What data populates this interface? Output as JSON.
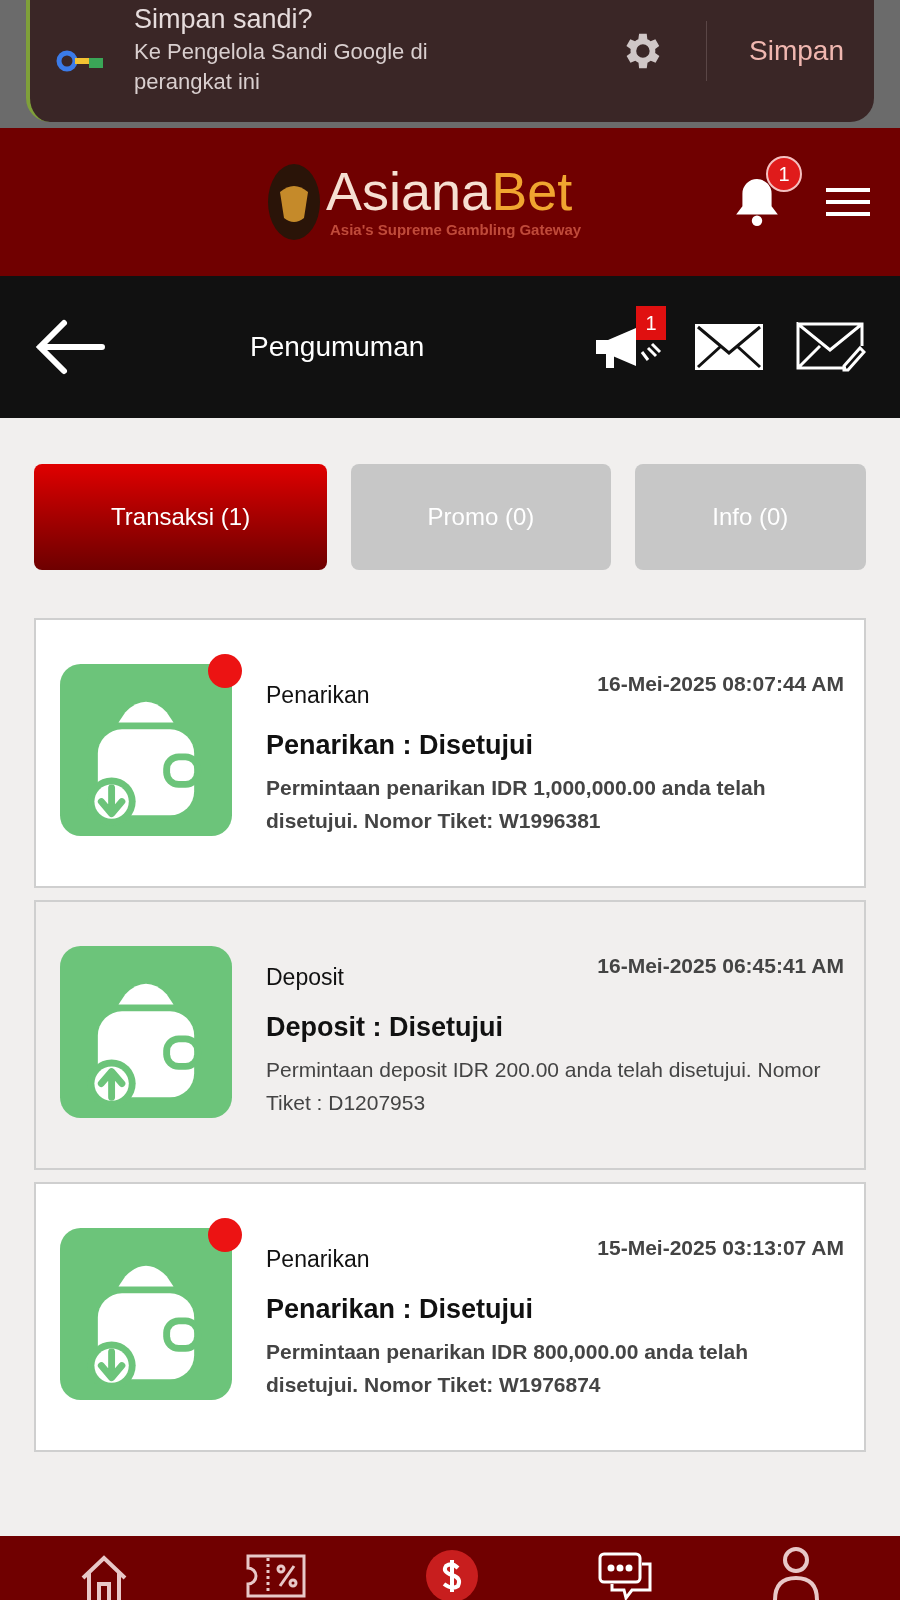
{
  "password_prompt": {
    "title": "Simpan sandi?",
    "message": "Ke Pengelola Sandi Google di perangkat ini",
    "save_button": "Simpan"
  },
  "header": {
    "logo_primary": "Asiana",
    "logo_accent": "Bet",
    "tagline": "Asia's Supreme Gambling Gateway",
    "bell_badge": "1"
  },
  "subheader": {
    "title": "Pengumuman",
    "megaphone_badge": "1"
  },
  "tabs": [
    {
      "label": "Transaksi (1)",
      "selected": true
    },
    {
      "label": "Promo (0)",
      "selected": false
    },
    {
      "label": "Info (0)",
      "selected": false
    }
  ],
  "notifications": [
    {
      "kind": "withdrawal",
      "unread": true,
      "category": "Penarikan",
      "time": "16-Mei-2025 08:07:44 AM",
      "title": "Penarikan : Disetujui",
      "message": "Permintaan penarikan IDR 1,000,000.00 anda telah disetujui. Nomor Tiket: W1996381"
    },
    {
      "kind": "deposit",
      "unread": false,
      "category": "Deposit",
      "time": "16-Mei-2025 06:45:41 AM",
      "title": "Deposit : Disetujui",
      "message": "Permintaan deposit IDR 200.00 anda telah disetujui. Nomor Tiket : D1207953"
    },
    {
      "kind": "withdrawal",
      "unread": true,
      "category": "Penarikan",
      "time": "15-Mei-2025 03:13:07 AM",
      "title": "Penarikan : Disetujui",
      "message": "Permintaan penarikan IDR 800,000.00 anda telah disetujui. Nomor Tiket: W1976874"
    }
  ]
}
